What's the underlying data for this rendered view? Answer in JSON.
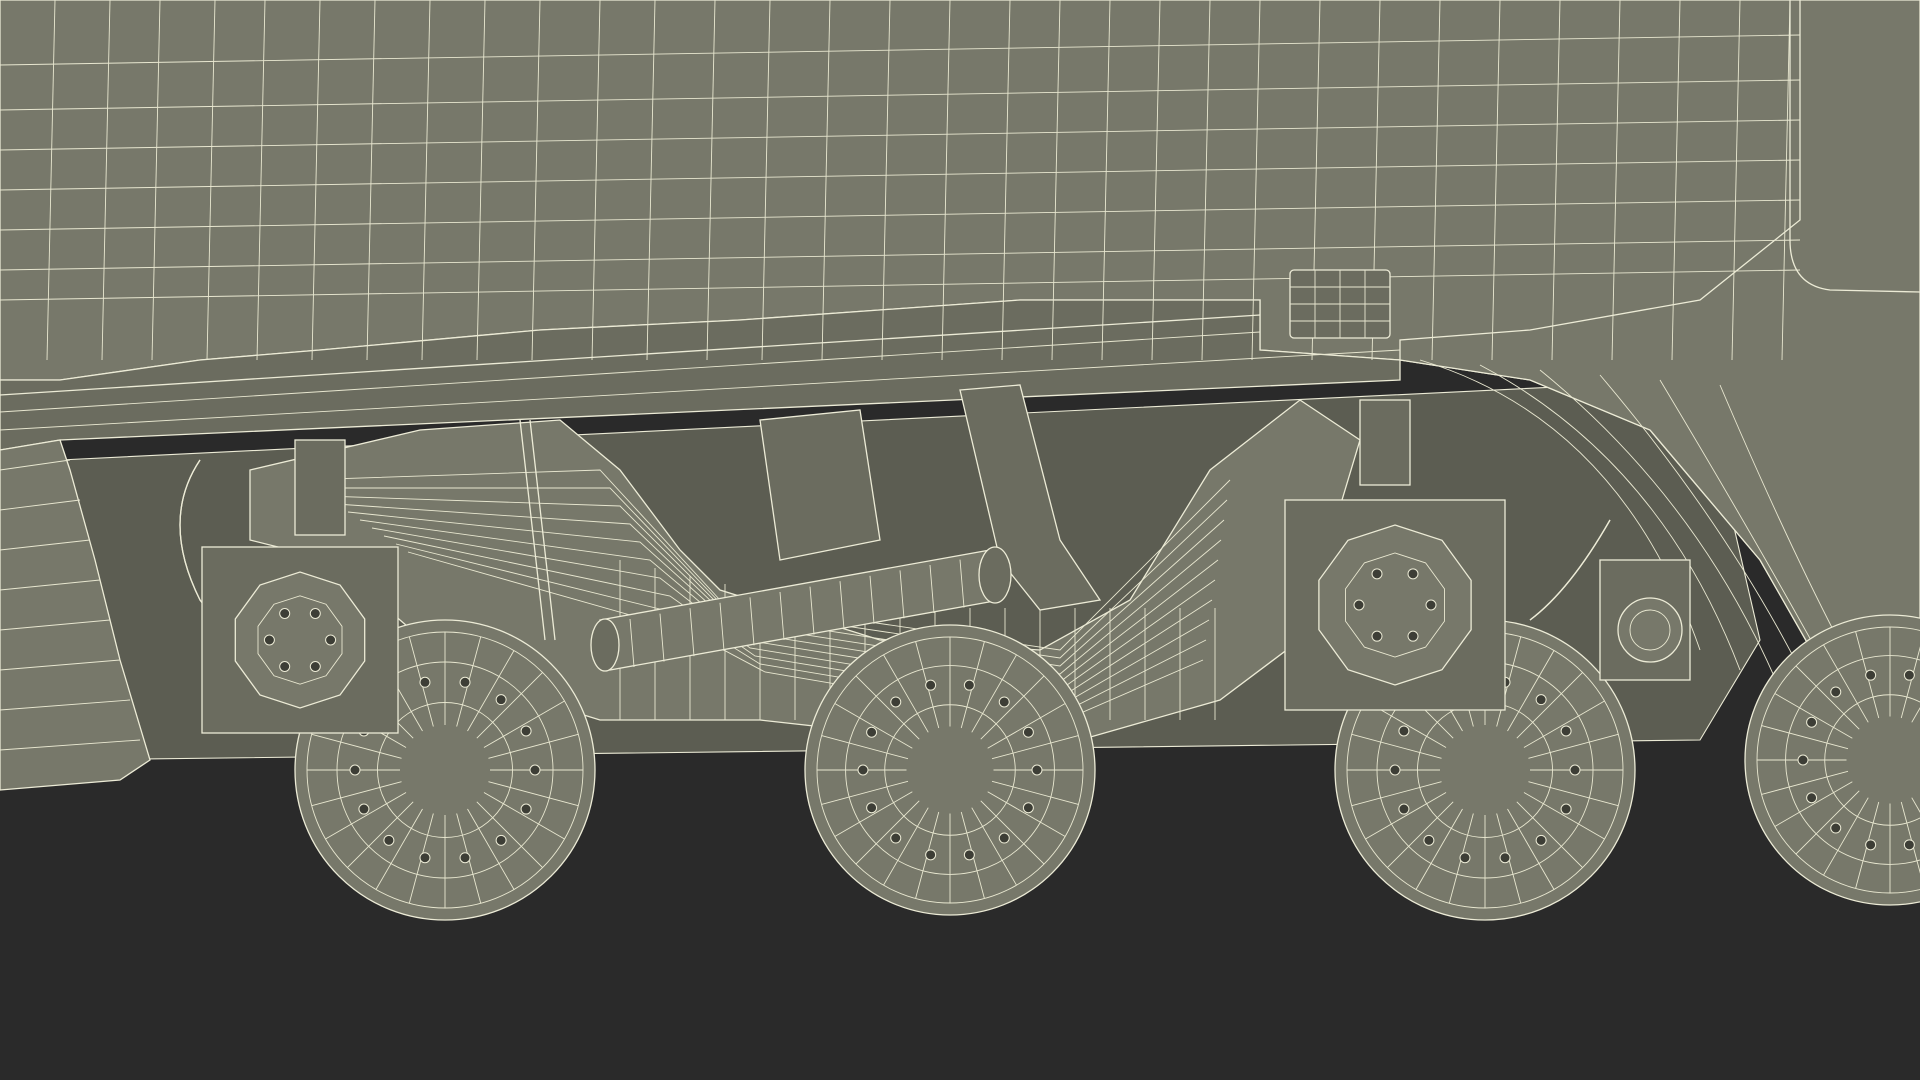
{
  "scene": {
    "subject": "train-bogie-wireframe",
    "colors": {
      "body": "#77786a",
      "body_dark": "#6b6c5f",
      "shadow": "#5c5d52",
      "wire": "#ecebd6",
      "ground": "#2a2a2a"
    },
    "wheel_count": 4,
    "axle_box_count": 2
  }
}
